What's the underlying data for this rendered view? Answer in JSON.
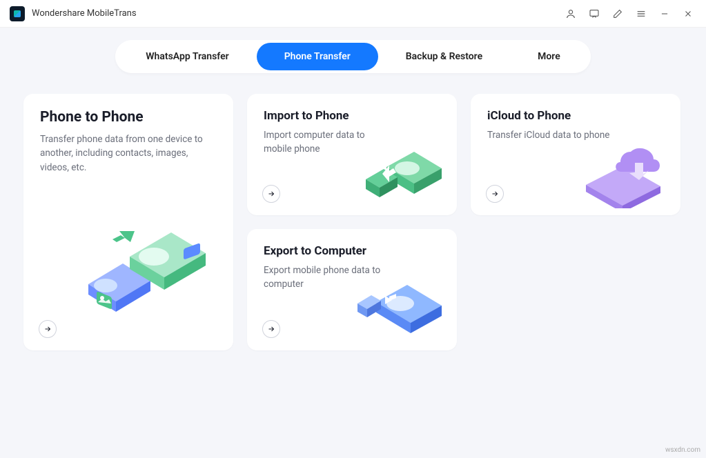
{
  "app": {
    "title": "Wondershare MobileTrans"
  },
  "tabs": {
    "whatsapp": "WhatsApp Transfer",
    "phone": "Phone Transfer",
    "backup": "Backup & Restore",
    "more": "More"
  },
  "cards": {
    "p2p": {
      "title": "Phone to Phone",
      "desc": "Transfer phone data from one device to another, including contacts, images, videos, etc."
    },
    "import": {
      "title": "Import to Phone",
      "desc": "Import computer data to mobile phone"
    },
    "icloud": {
      "title": "iCloud to Phone",
      "desc": "Transfer iCloud data to phone"
    },
    "export": {
      "title": "Export to Computer",
      "desc": "Export mobile phone data to computer"
    }
  },
  "watermark": "wsxdn.com"
}
